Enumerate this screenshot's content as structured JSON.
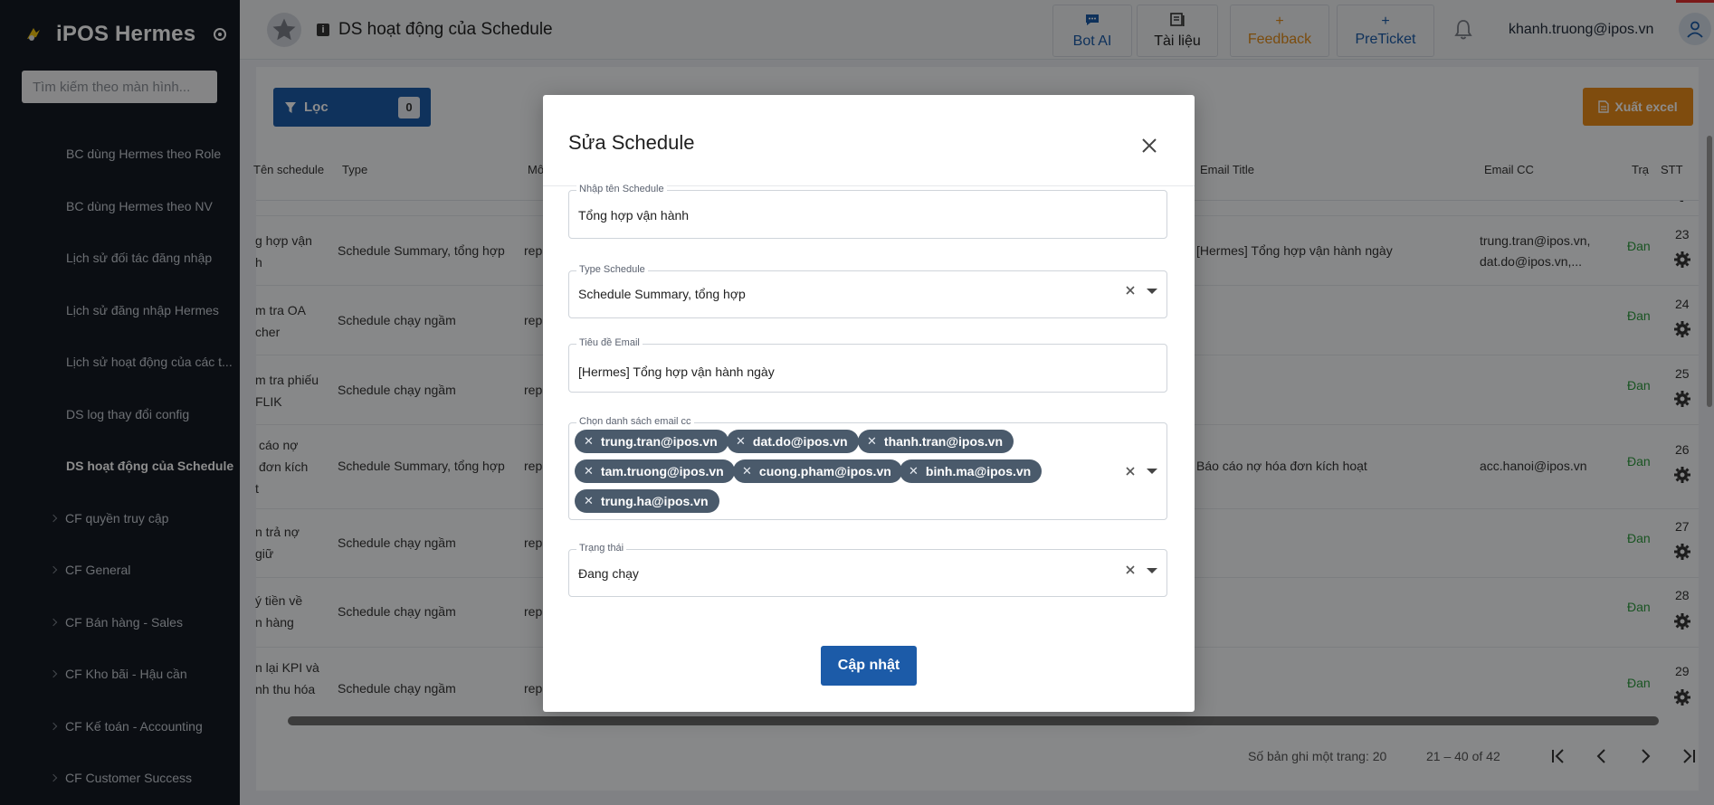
{
  "sidebar": {
    "brand": "iPOS Hermes",
    "search_placeholder": "Tìm kiếm theo màn hình...",
    "items": [
      {
        "label": "BC dùng Hermes theo Role"
      },
      {
        "label": "BC dùng Hermes theo NV"
      },
      {
        "label": "Lịch sử đối tác đăng nhập"
      },
      {
        "label": "Lịch sử đăng nhập Hermes"
      },
      {
        "label": "Lịch sử hoạt động của các t..."
      },
      {
        "label": "DS log thay đổi config"
      },
      {
        "label": "DS hoạt động của Schedule"
      }
    ],
    "groups": [
      {
        "label": "CF quyền truy cập"
      },
      {
        "label": "CF General"
      },
      {
        "label": "CF Bán hàng - Sales"
      },
      {
        "label": "CF Kho bãi - Hậu cần"
      },
      {
        "label": "CF Kế toán - Accounting"
      },
      {
        "label": "CF Customer Success"
      }
    ]
  },
  "header": {
    "page_title": "DS hoạt động của Schedule",
    "buttons": {
      "bot_ai": "Bot AI",
      "docs": "Tài liệu",
      "feedback": "Feedback",
      "preticket": "PreTicket"
    },
    "user_email": "khanh.truong@ipos.vn"
  },
  "toolbar": {
    "filter_label": "Lọc",
    "filter_count": "0",
    "export_label": "Xuất excel"
  },
  "table": {
    "headers": {
      "name": "Tên schedule",
      "type": "Type",
      "desc": "Mô",
      "email_title": "Email Title",
      "email_cc": "Email CC",
      "status": "Trạ",
      "stt": "STT"
    },
    "dash": "-",
    "rows": [
      {
        "name_1": "g hợp vận",
        "name_2": "h",
        "type": "Schedule Summary, tổng hợp",
        "desc": "rep",
        "email_title": "[Hermes] Tổng hợp vận hành ngày",
        "cc_1": "trung.tran@ipos.vn,",
        "cc_2": "dat.do@ipos.vn,...",
        "status": "Đan",
        "stt": "23"
      },
      {
        "name_1": "m tra OA",
        "name_2": "cher",
        "type": "Schedule chạy ngầm",
        "desc": "rep",
        "email_title": "",
        "cc_1": "",
        "cc_2": "",
        "status": "Đan",
        "stt": "24"
      },
      {
        "name_1": "m tra phiếu",
        "name_2": "FLIK",
        "type": "Schedule chạy ngầm",
        "desc": "rep",
        "email_title": "",
        "cc_1": "",
        "cc_2": "",
        "status": "Đan",
        "stt": "25"
      },
      {
        "name_1": "cáo nợ",
        "name_2": "đơn kích",
        "name_3": "t",
        "type": "Schedule Summary, tổng hợp",
        "desc": "rep",
        "email_title": "Báo cáo nợ hóa đơn kích hoạt",
        "cc_1": "acc.hanoi@ipos.vn",
        "cc_2": "",
        "status": "Đan",
        "stt": "26"
      },
      {
        "name_1": "n trả nợ",
        "name_2": "giữ",
        "type": "Schedule chạy ngầm",
        "desc": "rep",
        "email_title": "",
        "cc_1": "",
        "cc_2": "",
        "status": "Đan",
        "stt": "27"
      },
      {
        "name_1": "ý tiền về",
        "name_2": "n hàng",
        "type": "Schedule chạy ngầm",
        "desc": "rep",
        "email_title": "",
        "cc_1": "",
        "cc_2": "",
        "status": "Đan",
        "stt": "28"
      },
      {
        "name_1": "n lại KPI và",
        "name_2": "nh thu hóa",
        "type": "Schedule chạy ngầm",
        "desc": "rep",
        "email_title": "",
        "cc_1": "",
        "cc_2": "",
        "status": "Đan",
        "stt": "29"
      }
    ]
  },
  "pagination": {
    "rows_per_page": "Số bản ghi một trang: 20",
    "range": "21 – 40 of 42"
  },
  "modal": {
    "title": "Sửa Schedule",
    "fields": {
      "name": {
        "label": "Nhập tên Schedule",
        "value": "Tổng hợp vận hành"
      },
      "type": {
        "label": "Type Schedule",
        "value": "Schedule Summary, tổng hợp"
      },
      "email_title": {
        "label": "Tiêu đề Email",
        "value": "[Hermes] Tổng hợp vận hành ngày"
      },
      "email_cc": {
        "label": "Chọn danh sách email cc",
        "chips": [
          "trung.tran@ipos.vn",
          "dat.do@ipos.vn",
          "thanh.tran@ipos.vn",
          "tam.truong@ipos.vn",
          "cuong.pham@ipos.vn",
          "binh.ma@ipos.vn",
          "trung.ha@ipos.vn"
        ]
      },
      "status": {
        "label": "Trạng thái",
        "value": "Đang chạy"
      }
    },
    "submit_label": "Cập nhật"
  },
  "colors": {
    "primary": "#1c5ba8",
    "accent_orange": "#e88a1a",
    "sidebar_bg": "#141a24",
    "chip_bg": "#4a5a6b",
    "status_green": "#2e9a3e"
  }
}
